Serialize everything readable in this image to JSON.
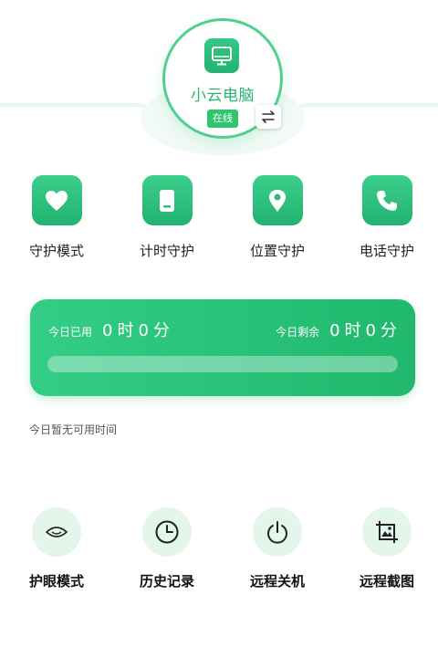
{
  "device": {
    "name": "小云电脑",
    "status": "在线"
  },
  "features": [
    {
      "label": "守护模式",
      "icon": "heart-icon"
    },
    {
      "label": "计时守护",
      "icon": "phone-icon"
    },
    {
      "label": "位置守护",
      "icon": "location-pin-icon"
    },
    {
      "label": "电话守护",
      "icon": "phone-call-icon"
    }
  ],
  "usage": {
    "used_caption": "今日已用",
    "used_hours": "0",
    "used_minutes": "0",
    "remaining_caption": "今日剩余",
    "remaining_hours": "0",
    "remaining_minutes": "0",
    "hour_unit": "时",
    "minute_unit": "分",
    "progress_fraction": 0,
    "no_time_text": "今日暂无可用时间"
  },
  "tools": [
    {
      "label": "护眼模式",
      "icon": "eye-icon"
    },
    {
      "label": "历史记录",
      "icon": "clock-icon"
    },
    {
      "label": "远程关机",
      "icon": "power-icon"
    },
    {
      "label": "远程截图",
      "icon": "screenshot-icon"
    }
  ],
  "colors": {
    "accent": "#2fc57a",
    "accent_dark": "#1fb86c",
    "tool_bg": "#e4f6ec"
  }
}
